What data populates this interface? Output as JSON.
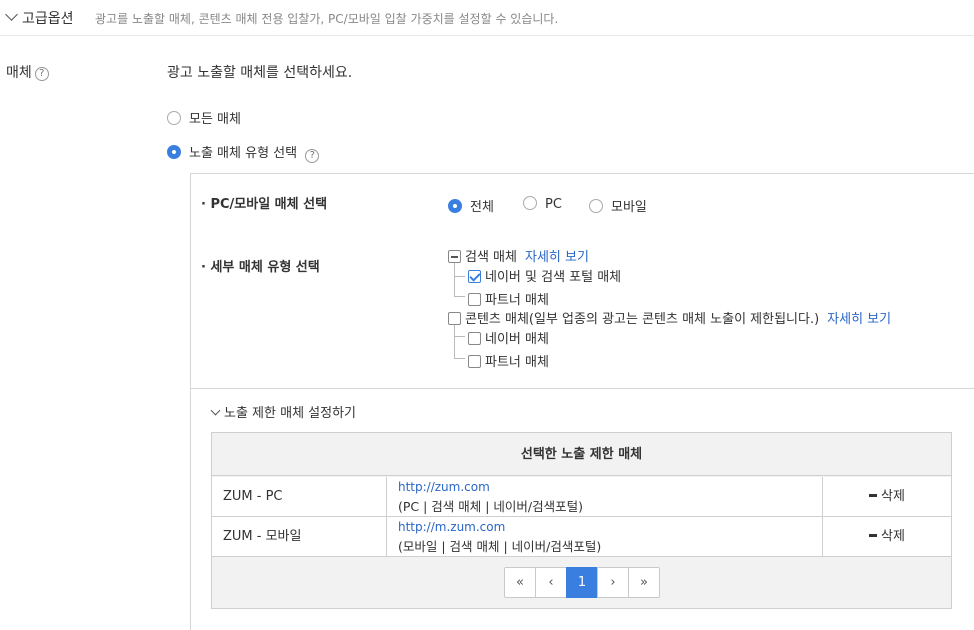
{
  "advanced": {
    "title": "고급옵션",
    "description": "광고를 노출할 매체, 콘텐츠 매체 전용 입찰가, PC/모바일 입찰 가중치를 설정할 수 있습니다."
  },
  "media": {
    "label": "매체",
    "help": "?",
    "prompt": "광고 노출할 매체를 선택하세요.",
    "options": [
      {
        "label": "모든 매체",
        "selected": false
      },
      {
        "label": "노출 매체 유형 선택",
        "selected": true
      }
    ],
    "pc_mobile": {
      "label": "· PC/모바일 매체 선택",
      "options": [
        {
          "label": "전체",
          "selected": true
        },
        {
          "label": "PC",
          "selected": false
        },
        {
          "label": "모바일",
          "selected": false
        }
      ]
    },
    "detail": {
      "label": "· 세부 매체 유형 선택",
      "search": {
        "label": "검색 매체",
        "link": "자세히 보기",
        "children": [
          {
            "label": "네이버 및 검색 포털 매체",
            "checked": true
          },
          {
            "label": "파트너 매체",
            "checked": false
          }
        ]
      },
      "content": {
        "label": "콘텐츠 매체(일부 업종의 광고는 콘텐츠 매체 노출이 제한됩니다.)",
        "link": "자세히 보기",
        "children": [
          {
            "label": "네이버 매체",
            "checked": false
          },
          {
            "label": "파트너 매체",
            "checked": false
          }
        ]
      }
    }
  },
  "limit": {
    "toggle": "노출 제한 매체 설정하기",
    "table_header": "선택한 노출 제한 매체",
    "rows": [
      {
        "name": "ZUM - PC",
        "url": "http://zum.com",
        "path": "(PC | 검색 매체 | 네이버/검색포털)",
        "action": "삭제"
      },
      {
        "name": "ZUM - 모바일",
        "url": "http://m.zum.com",
        "path": "(모바일 | 검색 매체 | 네이버/검색포털)",
        "action": "삭제"
      }
    ],
    "pager": {
      "first": "«",
      "prev": "‹",
      "current": "1",
      "next": "›",
      "last": "»"
    }
  }
}
